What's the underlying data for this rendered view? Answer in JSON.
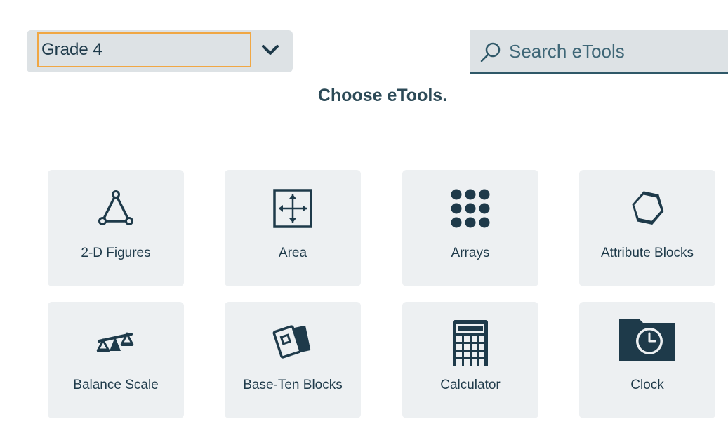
{
  "grade_selector": {
    "value": "Grade 4"
  },
  "search": {
    "placeholder": "Search eTools"
  },
  "heading": "Choose eTools.",
  "tools": [
    {
      "label": "2-D Figures",
      "icon": "triangle-icon"
    },
    {
      "label": "Area",
      "icon": "area-grid-arrows-icon"
    },
    {
      "label": "Arrays",
      "icon": "dot-array-icon"
    },
    {
      "label": "Attribute Blocks",
      "icon": "hexagon-icon"
    },
    {
      "label": "Balance Scale",
      "icon": "balance-scale-icon"
    },
    {
      "label": "Base-Ten Blocks",
      "icon": "base-ten-cards-icon"
    },
    {
      "label": "Calculator",
      "icon": "calculator-icon"
    },
    {
      "label": "Clock",
      "icon": "clock-icon"
    }
  ],
  "colors": {
    "icon": "#1e3a4a",
    "tile_bg": "#edf0f2",
    "focus_outline": "#f0a744",
    "control_bg": "#dde2e5"
  }
}
